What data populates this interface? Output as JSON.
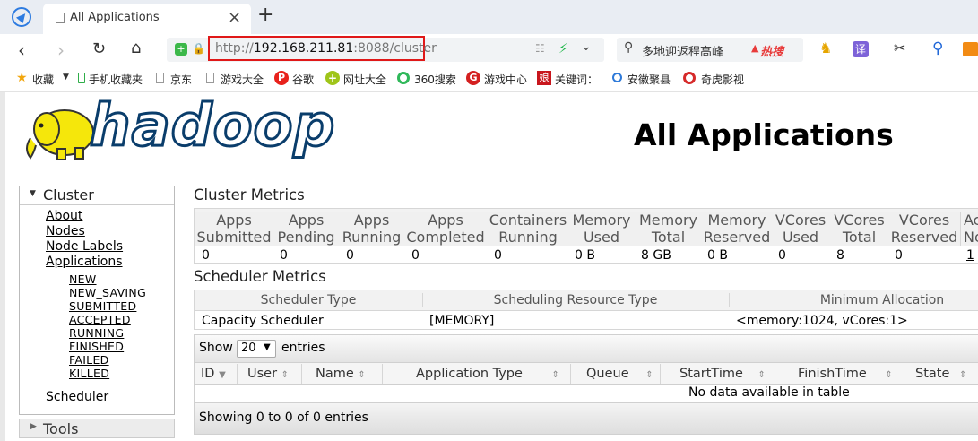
{
  "browser": {
    "tab_title": "All Applications",
    "new_tab": "+",
    "close_tab": "×",
    "url_prefix": "http://",
    "url_host": "192.168.211.81",
    "url_rest": ":8088/cluster",
    "search_text": "多地迎返程高峰",
    "hot_label": "热搜",
    "translate_label": "译"
  },
  "bookmarks": [
    {
      "label": "收藏"
    },
    {
      "label": "手机收藏夹"
    },
    {
      "label": "京东"
    },
    {
      "label": "游戏大全"
    },
    {
      "label": "谷歌"
    },
    {
      "label": "网址大全"
    },
    {
      "label": "360搜索"
    },
    {
      "label": "游戏中心"
    },
    {
      "label": "关键词："
    },
    {
      "label": "安徽聚县"
    },
    {
      "label": "奇虎影视"
    }
  ],
  "page": {
    "logo_text": "hadoop",
    "title": "All Applications"
  },
  "sidebar": {
    "cluster_label": "Cluster",
    "links": [
      "About",
      "Nodes",
      "Node Labels",
      "Applications"
    ],
    "app_states": [
      "NEW",
      "NEW_SAVING",
      "SUBMITTED",
      "ACCEPTED",
      "RUNNING",
      "FINISHED",
      "FAILED",
      "KILLED"
    ],
    "scheduler_link": "Scheduler",
    "tools_label": "Tools"
  },
  "cluster_metrics": {
    "heading": "Cluster Metrics",
    "headers": [
      [
        "Apps",
        "Submitted"
      ],
      [
        "Apps",
        "Pending"
      ],
      [
        "Apps",
        "Running"
      ],
      [
        "Apps",
        "Completed"
      ],
      [
        "Containers",
        "Running"
      ],
      [
        "Memory",
        "Used"
      ],
      [
        "Memory",
        "Total"
      ],
      [
        "Memory",
        "Reserved"
      ],
      [
        "VCores",
        "Used"
      ],
      [
        "VCores",
        "Total"
      ],
      [
        "VCores",
        "Reserved"
      ],
      [
        "Ac",
        "No"
      ]
    ],
    "values": [
      "0",
      "0",
      "0",
      "0",
      "0",
      "0 B",
      "8 GB",
      "0 B",
      "0",
      "8",
      "0",
      "1"
    ]
  },
  "scheduler_metrics": {
    "heading": "Scheduler Metrics",
    "headers": [
      "Scheduler Type",
      "Scheduling Resource Type",
      "Minimum Allocation"
    ],
    "values": [
      "Capacity Scheduler",
      "[MEMORY]",
      "<memory:1024, vCores:1>"
    ]
  },
  "apps_table": {
    "show_label": "Show",
    "entries_value": "20",
    "entries_label": "entries",
    "columns": [
      "ID",
      "User",
      "Name",
      "Application Type",
      "Queue",
      "StartTime",
      "FinishTime",
      "State"
    ],
    "empty_message": "No data available in table",
    "info": "Showing 0 to 0 of 0 entries"
  }
}
